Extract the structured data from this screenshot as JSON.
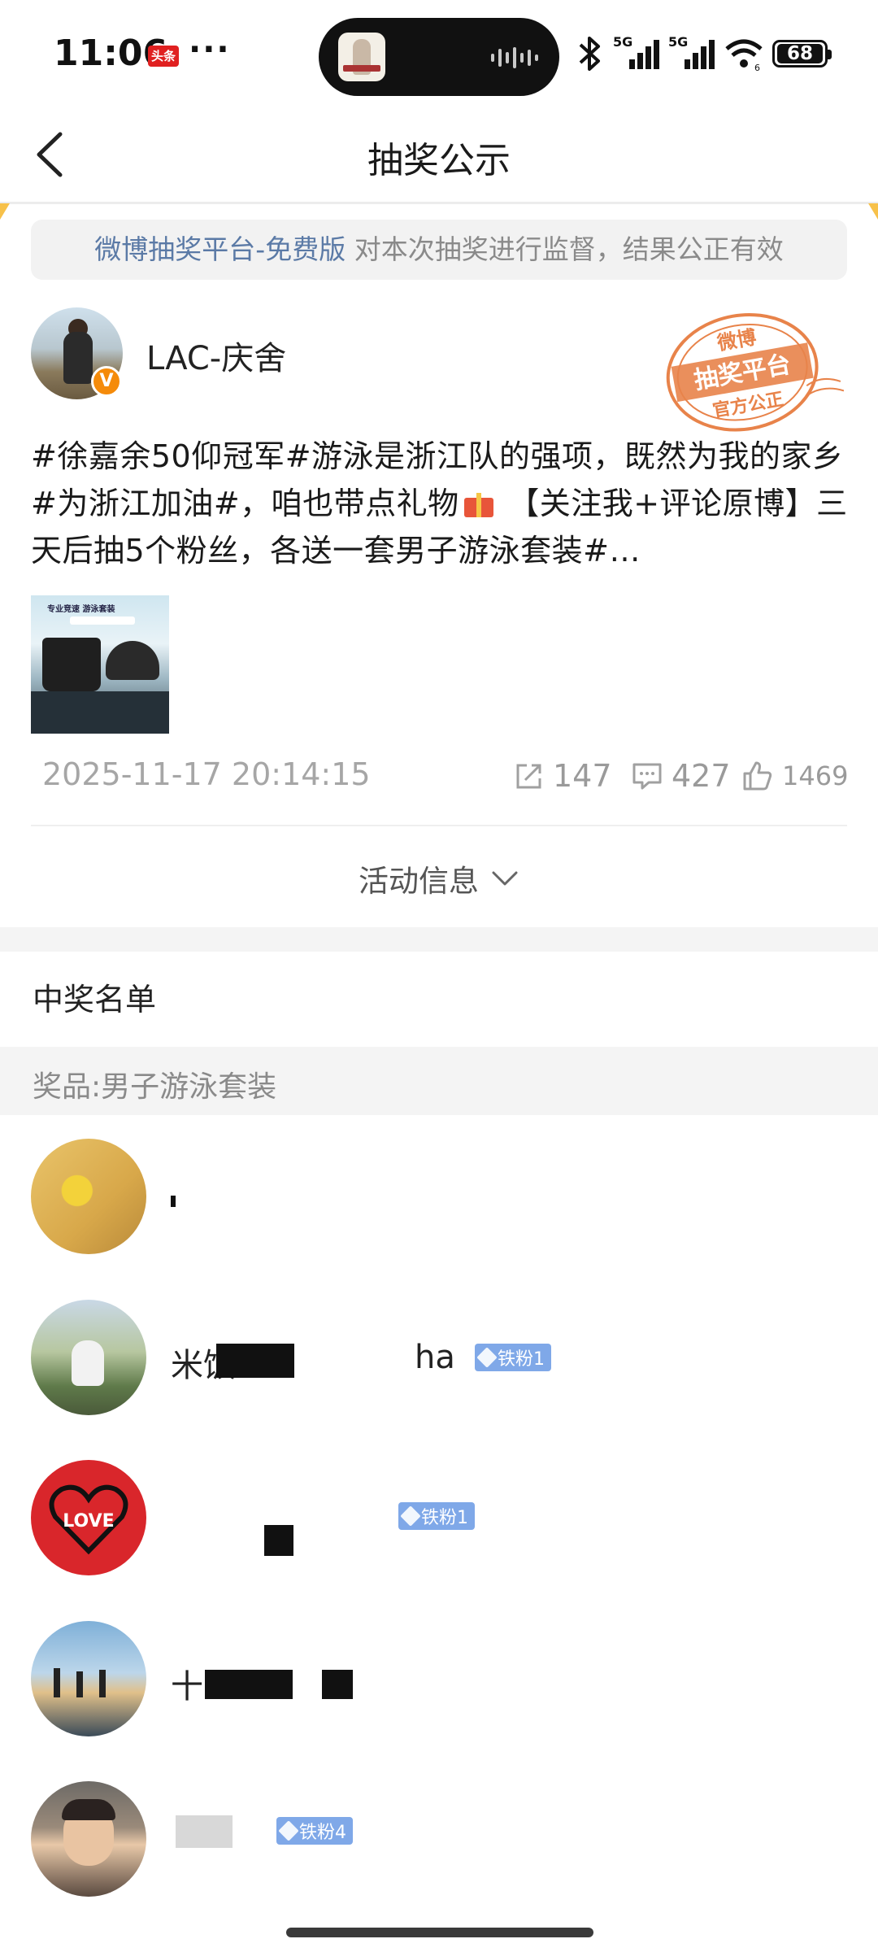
{
  "status_bar": {
    "time": "11:06",
    "news_badge": "头条",
    "more": "···",
    "battery": "68"
  },
  "nav": {
    "title": "抽奖公示"
  },
  "notice": {
    "platform": "微博抽奖平台-免费版",
    "text": " 对本次抽奖进行监督，结果公正有效"
  },
  "post": {
    "author": "LAC-庆舍",
    "verified_badge": "V",
    "stamp": {
      "top": "微博",
      "middle": "抽奖平台",
      "bottom": "官方公正"
    },
    "text_part1": "#徐嘉余50仰冠军#游泳是浙江队的强项，既然为我的家乡#为浙江加油#，咱也带点礼物",
    "text_part2": " 【关注我+评论原博】三天后抽5个粉丝，各送一套男子游泳套装#…",
    "thumb_caption": "专业竞速 游泳套装",
    "date": "2025-11-17 20:14:15",
    "reposts": "147",
    "comments": "427",
    "likes": "1469"
  },
  "activity": {
    "label": "活动信息"
  },
  "winners_section": {
    "title": "中奖名单",
    "prize": "奖品:男子游泳套装",
    "winners": [
      {
        "name": "",
        "badge": ""
      },
      {
        "name": "米饭",
        "name_tail": "ha",
        "badge": "铁粉1"
      },
      {
        "name": "",
        "badge": "铁粉1"
      },
      {
        "name": "十",
        "badge": ""
      },
      {
        "name": "",
        "badge": "铁粉4"
      }
    ]
  },
  "colors": {
    "accent_orange": "#f58b0a",
    "fan_badge": "#7fa8e8",
    "link_blue": "#5b7aa6",
    "stamp": "#e8834a"
  }
}
